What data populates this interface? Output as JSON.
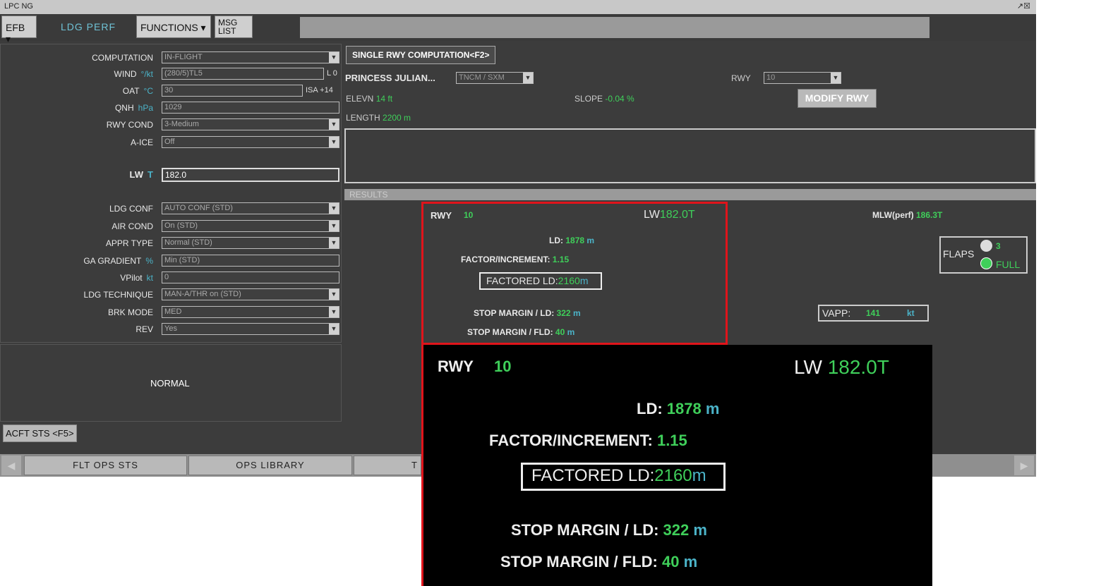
{
  "window": {
    "title": "LPC NG",
    "controls": "↗☒"
  },
  "menu": {
    "efb": "EFB",
    "ldg_perf": "LDG PERF",
    "functions": "FUNCTIONS",
    "msg_list_1": "MSG",
    "msg_list_2": "LIST"
  },
  "form": {
    "computation": {
      "label": "COMPUTATION",
      "value": "IN-FLIGHT"
    },
    "wind": {
      "label": "WIND",
      "unit": "°/kt",
      "value": "(280/5)TL5",
      "side": "L 0"
    },
    "oat": {
      "label": "OAT",
      "unit": "°C",
      "value": "30",
      "side": "ISA +14"
    },
    "qnh": {
      "label": "QNH",
      "unit": "hPa",
      "value": "1029"
    },
    "rwy_cond": {
      "label": "RWY COND",
      "value": "3-Medium"
    },
    "a_ice": {
      "label": "A-ICE",
      "value": "Off"
    },
    "lw": {
      "label": "LW",
      "unit": "T",
      "value": "182.0"
    },
    "ldg_conf": {
      "label": "LDG CONF",
      "value": "AUTO CONF (STD)"
    },
    "air_cond": {
      "label": "AIR COND",
      "value": "On (STD)"
    },
    "appr_type": {
      "label": "APPR TYPE",
      "value": "Normal (STD)"
    },
    "ga_gradient": {
      "label": "GA GRADIENT",
      "unit": "%",
      "value": "Min (STD)"
    },
    "vpilot": {
      "label": "VPilot",
      "unit": "kt",
      "value": "0"
    },
    "ldg_technique": {
      "label": "LDG TECHNIQUE",
      "value": "MAN-A/THR on (STD)"
    },
    "brk_mode": {
      "label": "BRK MODE",
      "value": "MED"
    },
    "rev": {
      "label": "REV",
      "value": "Yes"
    }
  },
  "status": {
    "normal": "NORMAL",
    "acft_sts": "ACFT STS <F5>"
  },
  "bottom": {
    "flt_ops_sts": "FLT OPS STS",
    "ops_library": "OPS LIBRARY",
    "third": "T",
    "left_arrow": "◀",
    "right_arrow": "▶"
  },
  "rwy_panel": {
    "tab": "SINGLE RWY COMPUTATION<F2>",
    "airport": "PRINCESS JULIAN...",
    "airport_code": "TNCM / SXM",
    "rwy_label": "RWY",
    "rwy_value": "10",
    "elevn_label": "ELEVN",
    "elevn_value": "14 ft",
    "slope_label": "SLOPE",
    "slope_value": "-0.04 %",
    "length_label": "LENGTH",
    "length_value": "2200 m",
    "modify": "MODIFY RWY"
  },
  "results": {
    "header": "RESULTS",
    "rwy_label": "RWY",
    "rwy_value": "10",
    "lw_label": "LW",
    "lw_value": "182.0",
    "lw_unit": "T",
    "ld_label": "LD:",
    "ld_value": "1878",
    "ld_unit": "m",
    "factor_label": "FACTOR/INCREMENT:",
    "factor_value": "1.15",
    "fld_label": "FACTORED LD:",
    "fld_value": "2160",
    "fld_unit": "m",
    "stop_ld_label": "STOP MARGIN / LD:",
    "stop_ld_value": "322",
    "stop_ld_unit": "m",
    "stop_fld_label": "STOP MARGIN / FLD:",
    "stop_fld_value": "40",
    "stop_fld_unit": "m",
    "mlw_label": "MLW(perf)",
    "mlw_value": "186.3",
    "mlw_unit": "T",
    "flaps_label": "FLAPS",
    "flaps_3": "3",
    "flaps_full": "FULL",
    "vapp_label": "VAPP:",
    "vapp_value": "141",
    "vapp_unit": "kt"
  },
  "colors": {
    "green": "#3fcf5a",
    "cyan": "#4bb3c8",
    "highlight": "#e0141b"
  },
  "icons": [
    "dropdown-arrow-icon",
    "window-controls-icon",
    "radio-icon"
  ]
}
